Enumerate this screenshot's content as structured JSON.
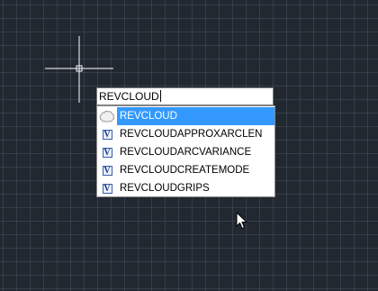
{
  "command_line": {
    "typed_text": "REVCLOUD"
  },
  "autocomplete": {
    "items": [
      {
        "label": "REVCLOUD",
        "icon": "revcloud-command-icon",
        "selected": true
      },
      {
        "label": "REVCLOUDAPPROXARCLEN",
        "icon": "system-variable-icon",
        "selected": false
      },
      {
        "label": "REVCLOUDARCVARIANCE",
        "icon": "system-variable-icon",
        "selected": false
      },
      {
        "label": "REVCLOUDCREATEMODE",
        "icon": "system-variable-icon",
        "selected": false
      },
      {
        "label": "REVCLOUDGRIPS",
        "icon": "system-variable-icon",
        "selected": false
      }
    ],
    "variable_icon_glyph": "V"
  },
  "colors": {
    "background": "#212830",
    "selection": "#3399ff",
    "crosshair": "#ffffff"
  }
}
